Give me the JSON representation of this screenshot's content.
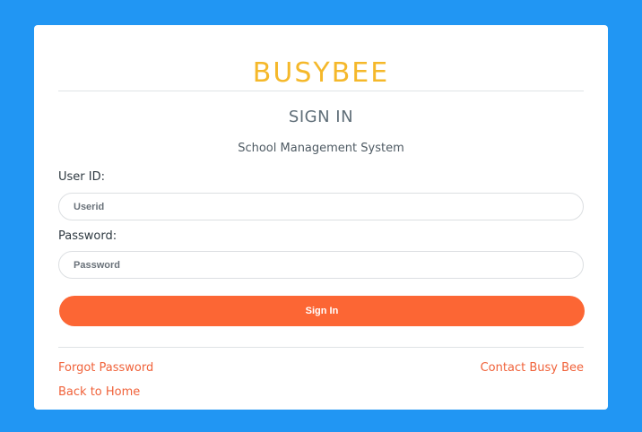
{
  "brand": {
    "logo_text": "BUSYBEE"
  },
  "form": {
    "title": "SIGN IN",
    "subtitle": "School Management System",
    "userid_label": "User ID:",
    "userid_placeholder": "Userid",
    "userid_value": "",
    "password_label": "Password:",
    "password_placeholder": "Password",
    "password_value": "",
    "submit_label": "Sign In"
  },
  "links": {
    "forgot_password": "Forgot Password",
    "contact": "Contact Busy Bee",
    "back_home": "Back to Home"
  },
  "colors": {
    "background": "#2196f3",
    "card": "#ffffff",
    "logo": "#f5b82a",
    "accent": "#fc6634",
    "link": "#f0623a"
  }
}
